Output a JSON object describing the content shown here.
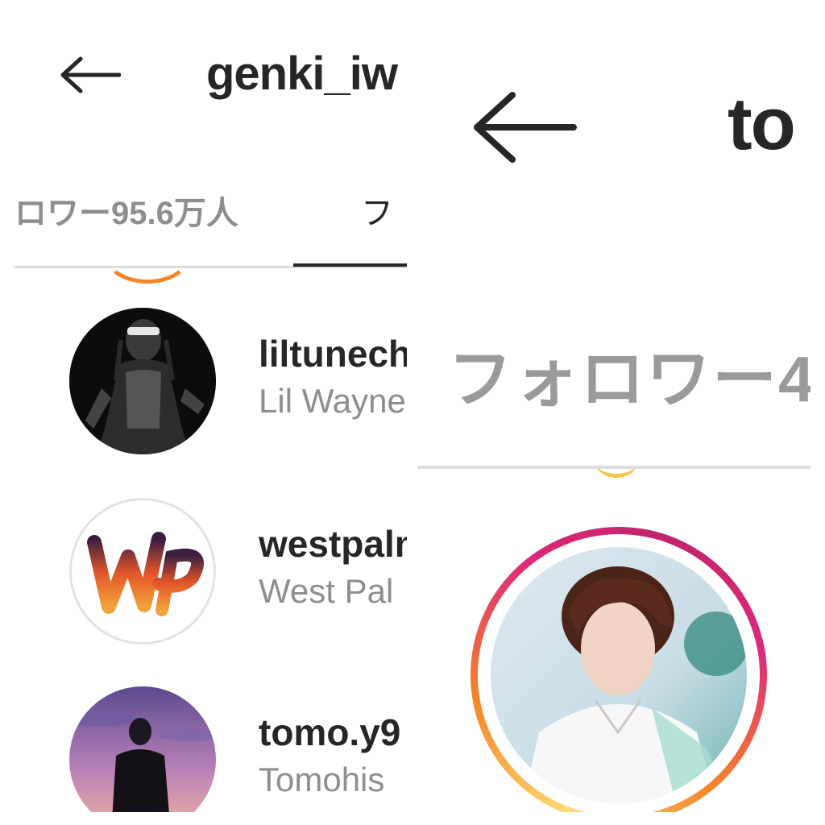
{
  "left": {
    "title": "genki_iw",
    "tabs": {
      "followers": "ロワー95.6万人",
      "following": "フ"
    },
    "users": [
      {
        "username": "liltunechi",
        "fullname": "Lil Wayne",
        "avatar": "lil-wayne-photo"
      },
      {
        "username": "westpalm",
        "fullname": "West Pal",
        "avatar": "west-palm-logo"
      },
      {
        "username": "tomo.y9",
        "fullname": "Tomohis",
        "avatar": "tomo-y9-photo"
      }
    ]
  },
  "right": {
    "title": "to",
    "tab": "フォロワー4",
    "avatar": "profile-photo"
  },
  "colors": {
    "text_primary": "#262626",
    "text_secondary": "#8e8e8e",
    "divider": "#dbdbdb",
    "story_ring": [
      "#feda75",
      "#f58529",
      "#dd2a7b"
    ]
  }
}
